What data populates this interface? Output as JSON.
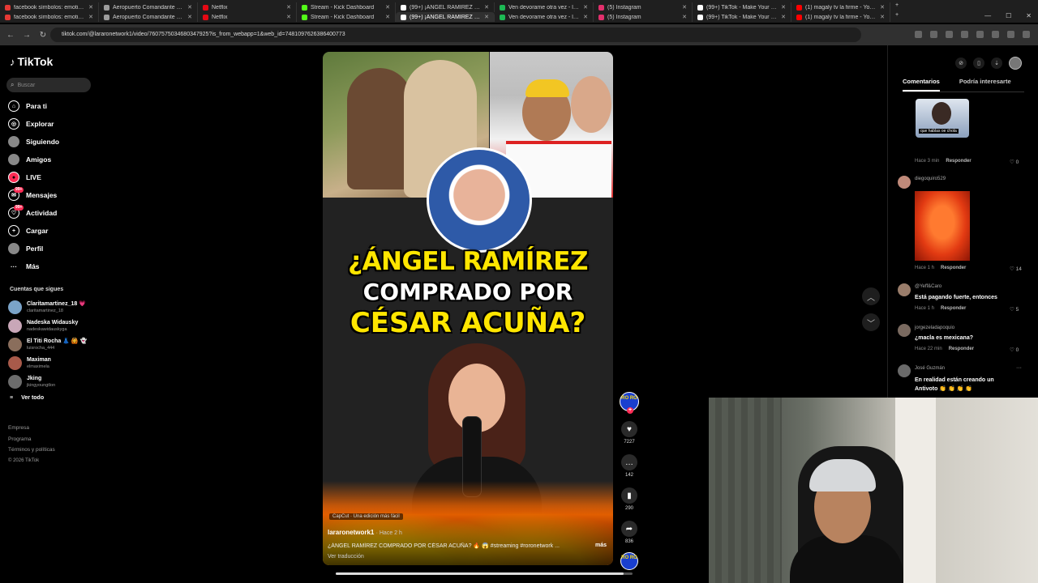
{
  "browser": {
    "tabs_row1": [
      {
        "title": "facebook símbolos: emoticono",
        "color": "#e53935"
      },
      {
        "title": "Aeropuerto Comandante FAP",
        "color": "#9e9e9e"
      },
      {
        "title": "Netflix",
        "color": "#e50914"
      },
      {
        "title": "Stream - Kick Dashboard",
        "color": "#53fc18"
      },
      {
        "title": "(99+) ¡ÁNGEL RAMÍREZ COMP",
        "color": "#ffffff"
      },
      {
        "title": "Ven devorame otra vez - letra",
        "color": "#1db954"
      },
      {
        "title": "(5) Instagram",
        "color": "#e1306c"
      },
      {
        "title": "(99+) TikTok - Make Your Day",
        "color": "#ffffff"
      },
      {
        "title": "(1) magaly tv la firme - YouTube",
        "color": "#ff0000"
      }
    ],
    "tabs_row2": [
      {
        "title": "facebook símbolos: emoticono",
        "color": "#e53935"
      },
      {
        "title": "Aeropuerto Comandante FAP",
        "color": "#9e9e9e"
      },
      {
        "title": "Netflix",
        "color": "#e50914"
      },
      {
        "title": "Stream - Kick Dashboard",
        "color": "#53fc18"
      },
      {
        "title": "(99+) ¡ÁNGEL RAMÍREZ COMP",
        "color": "#ffffff",
        "active": true
      },
      {
        "title": "Ven devorame otra vez - letra",
        "color": "#1db954"
      },
      {
        "title": "(5) Instagram",
        "color": "#e1306c"
      },
      {
        "title": "(99+) TikTok - Make Your Day",
        "color": "#ffffff"
      },
      {
        "title": "(1) magaly tv la firme - YouTube",
        "color": "#ff0000"
      }
    ],
    "url": "tiktok.com/@lararonetwork1/video/7607575034680347925?is_from_webapp=1&web_id=7481097626386400773"
  },
  "sidebar": {
    "logo": "TikTok",
    "search_placeholder": "Buscar",
    "nav": [
      {
        "label": "Para ti",
        "icon": "home-icon"
      },
      {
        "label": "Explorar",
        "icon": "compass-icon"
      },
      {
        "label": "Siguiendo",
        "icon": "following-icon"
      },
      {
        "label": "Amigos",
        "icon": "friends-icon"
      },
      {
        "label": "LIVE",
        "icon": "live-icon"
      },
      {
        "label": "Mensajes",
        "icon": "messages-icon",
        "badge": "99+"
      },
      {
        "label": "Actividad",
        "icon": "activity-icon",
        "badge": "99+"
      },
      {
        "label": "Cargar",
        "icon": "upload-icon"
      },
      {
        "label": "Perfil",
        "icon": "profile-icon"
      },
      {
        "label": "Más",
        "icon": "more-icon"
      }
    ],
    "following_title": "Cuentas que sigues",
    "following": [
      {
        "name": "Claritamartinez_18 💗",
        "user": "claritamartinez_18",
        "color": "#7aa3c8"
      },
      {
        "name": "Nadeska Widausky",
        "user": "nadeskawidauskyga",
        "color": "#c9a7b8"
      },
      {
        "name": "El Titi Rocha 👗 🙆 👻",
        "user": "luisrocha_444",
        "color": "#8a6e5c"
      },
      {
        "name": "Maximan",
        "user": "elmaximela",
        "color": "#a85a4a"
      },
      {
        "name": "Jking",
        "user": "jkingyoungtlon",
        "color": "#6c6c6c"
      }
    ],
    "see_all": "Ver todo",
    "footer": [
      "Empresa",
      "Programa",
      "Términos y políticas",
      "© 2026 TikTok"
    ]
  },
  "video": {
    "headline_l1": "¿ÁNGEL RAMÍREZ",
    "headline_l2": "COMPRADO POR",
    "headline_l3": "CÉSAR ACUÑA?",
    "capcut": "CapCut · Una edición más fácil",
    "author": "lararonetwork1",
    "ago": "· Hace 2 h",
    "description": "¿ÁNGEL RAMÍREZ COMPRADO POR CÉSAR ACUÑA? 🔥 😱 #streaming #roronetwork ...",
    "more": "más",
    "translate": "Ver traducción",
    "progress": 0.97
  },
  "actions": {
    "avatar_text": "RO RO",
    "likes": "7227",
    "comments": "142",
    "saves": "290",
    "shares": "836"
  },
  "comments_panel": {
    "tab_comments": "Comentarios",
    "tab_interest": "Podría interesarte",
    "sticker_caption": "que hablas oe chola",
    "items": [
      {
        "meta": "Hace 3 min",
        "reply": "Responder",
        "likes": "0"
      },
      {
        "user": "diegoquiro529",
        "meta": "Hace 1 h",
        "reply": "Responder",
        "likes": "14",
        "avatar": "#c08a7a"
      },
      {
        "user": "@Yeff&Caro",
        "text": "Está pagando fuerte, entonces",
        "meta": "Hace 1 h",
        "reply": "Responder",
        "likes": "5",
        "avatar": "#9a7d6b"
      },
      {
        "user": "jorgezeladapoquio",
        "text": "¿macla es mexicana?",
        "meta": "Hace 22 min",
        "reply": "Responder",
        "likes": "0",
        "avatar": "#7a6a60"
      },
      {
        "user": "José Guzmán",
        "text": "En realidad están creando un Antivoto 👏 👏 👏 👏",
        "avatar": "#6a6a6a"
      }
    ]
  }
}
